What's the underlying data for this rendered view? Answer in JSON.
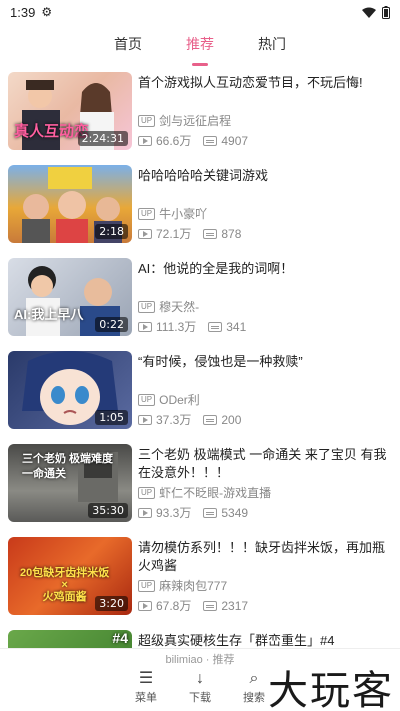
{
  "status_bar": {
    "time": "1:39"
  },
  "tabs": [
    {
      "label": "首页",
      "active": false
    },
    {
      "label": "推荐",
      "active": true
    },
    {
      "label": "热门",
      "active": false
    }
  ],
  "videos": [
    {
      "title": "首个游戏拟人互动恋爱节目，不玩后悔!",
      "up": "剑与远征启程",
      "views": "66.6万",
      "danmaku": "4907",
      "duration": "2:24:31",
      "thumb_text": "真人互动恋"
    },
    {
      "title": "哈哈哈哈哈关键词游戏",
      "up": "牛小豪吖",
      "views": "72.1万",
      "danmaku": "878",
      "duration": "2:18",
      "thumb_text": ""
    },
    {
      "title": "AI：他说的全是我的词啊！",
      "up": "穆天然-",
      "views": "111.3万",
      "danmaku": "341",
      "duration": "0:22",
      "thumb_text": "AI:我上早八"
    },
    {
      "title": "“有时候，侵蚀也是一种救赎”",
      "up": "ODer利",
      "views": "37.3万",
      "danmaku": "200",
      "duration": "1:05",
      "thumb_text": ""
    },
    {
      "title": "三个老奶 极端模式 一命通关 来了宝贝 有我在没意外！！！",
      "up": "虾仁不眨眼-游戏直播",
      "views": "93.3万",
      "danmaku": "5349",
      "duration": "35:30",
      "thumb_text": "三个老奶 极端难度\n一命通关"
    },
    {
      "title": "请勿模仿系列！！！缺牙齿拌米饭，再加瓶火鸡酱",
      "up": "麻辣肉包777",
      "views": "67.8万",
      "danmaku": "2317",
      "duration": "3:20",
      "thumb_text": "20包缺牙齿拌米饭\n×\n火鸡面酱"
    },
    {
      "title": "超级真实硬核生存「群峦重生」#4",
      "up": "",
      "views": "",
      "danmaku": "",
      "duration": "",
      "thumb_text": "#4"
    }
  ],
  "bottom_nav": {
    "caption": "bilimiao · 推荐",
    "items": [
      {
        "label": "菜单",
        "icon": "menu-icon"
      },
      {
        "label": "下载",
        "icon": "download-icon"
      },
      {
        "label": "搜索",
        "icon": "search-icon"
      }
    ]
  },
  "watermark": "大玩客",
  "colors": {
    "accent": "#e8608a",
    "meta": "#888888"
  }
}
